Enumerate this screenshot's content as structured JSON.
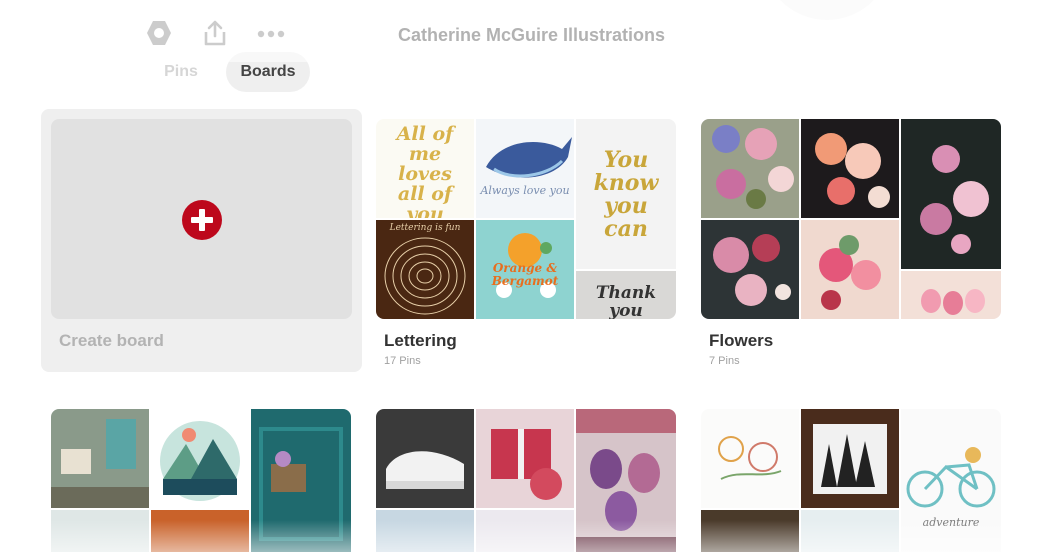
{
  "profile": {
    "title": "Catherine McGuire Illustrations"
  },
  "toolbar": {
    "icons": [
      "settings-hex-icon",
      "share-icon",
      "more-icon"
    ]
  },
  "tabs": [
    {
      "label": "Pins",
      "active": false
    },
    {
      "label": "Boards",
      "active": true
    }
  ],
  "create_board": {
    "label": "Create board",
    "accent": "#bd081c"
  },
  "boards": [
    {
      "title": "Lettering",
      "count": "17 Pins"
    },
    {
      "title": "Flowers",
      "count": "7 Pins"
    },
    {
      "title": "",
      "count": ""
    },
    {
      "title": "",
      "count": ""
    },
    {
      "title": "",
      "count": ""
    }
  ],
  "artwork": {
    "lettering_1": "All of me loves all of you",
    "lettering_2": "Always love you",
    "lettering_3": "You know you can",
    "lettering_4": "Orange & Bergamot",
    "lettering_5": "Thank you",
    "lettering_6": "Lettering is fun",
    "bike_caption": "adventure"
  }
}
